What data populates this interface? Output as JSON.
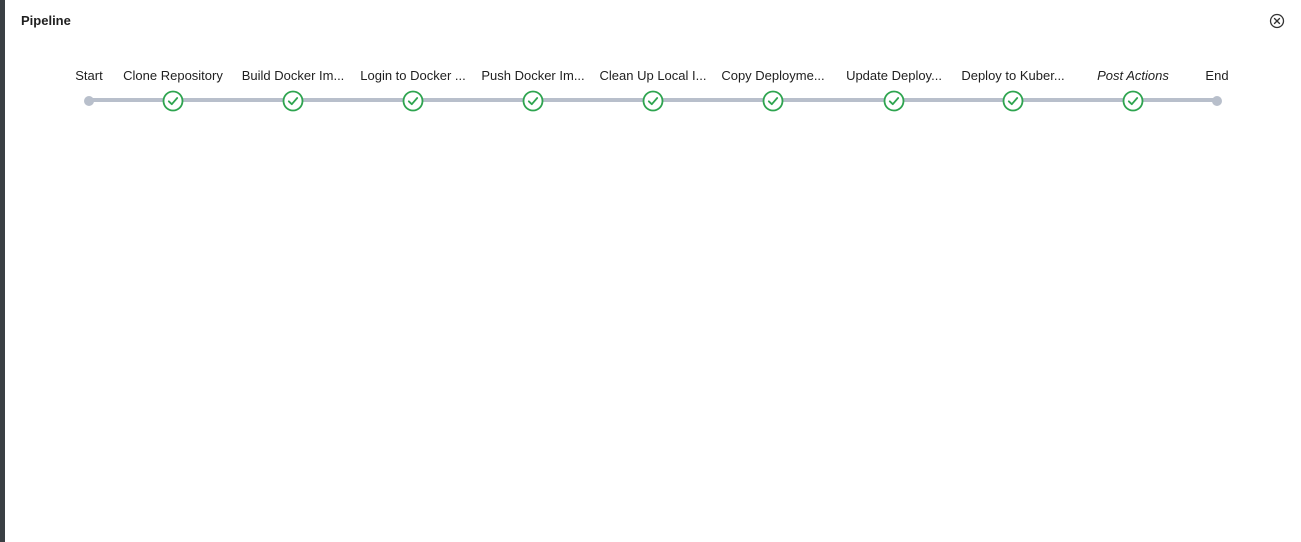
{
  "dialog": {
    "title": "Pipeline",
    "close_icon": "close-circle-icon"
  },
  "pipeline": {
    "status_color": "#2ea44f",
    "track_color": "#b8bfcb",
    "stages": [
      {
        "label": "Start",
        "kind": "terminal",
        "status": "none"
      },
      {
        "label": "Clone Repository",
        "kind": "step",
        "status": "success"
      },
      {
        "label": "Build Docker Im...",
        "kind": "step",
        "status": "success"
      },
      {
        "label": "Login to Docker ...",
        "kind": "step",
        "status": "success"
      },
      {
        "label": "Push Docker Im...",
        "kind": "step",
        "status": "success"
      },
      {
        "label": "Clean Up Local I...",
        "kind": "step",
        "status": "success"
      },
      {
        "label": "Copy Deployme...",
        "kind": "step",
        "status": "success"
      },
      {
        "label": "Update Deploy...",
        "kind": "step",
        "status": "success"
      },
      {
        "label": "Deploy to Kuber...",
        "kind": "step",
        "status": "success"
      },
      {
        "label": "Post Actions",
        "kind": "post",
        "status": "success"
      },
      {
        "label": "End",
        "kind": "terminal",
        "status": "none"
      }
    ]
  }
}
